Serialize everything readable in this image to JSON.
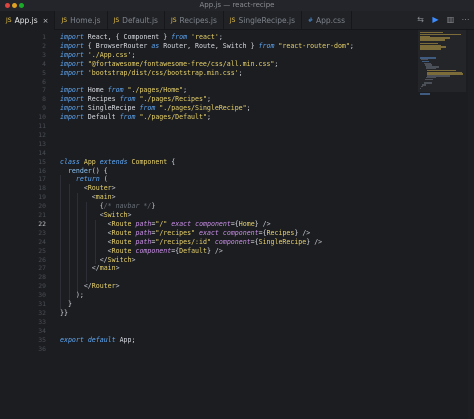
{
  "window": {
    "title": "App.js — react-recipe"
  },
  "tabs": [
    {
      "label": "App.js",
      "active": true
    },
    {
      "label": "Home.js",
      "active": false
    },
    {
      "label": "Default.js",
      "active": false
    },
    {
      "label": "Recipes.js",
      "active": false
    },
    {
      "label": "SingleRecipe.js",
      "active": false
    },
    {
      "label": "App.css",
      "active": false
    }
  ],
  "tab_close_glyph": "×",
  "tab_icon_glyph": "JS",
  "editor": {
    "current_line": 22,
    "line_numbers": [
      "1",
      "2",
      "3",
      "4",
      "5",
      "6",
      "7",
      "8",
      "9",
      "10",
      "11",
      "12",
      "13",
      "14",
      "15",
      "16",
      "17",
      "18",
      "19",
      "20",
      "21",
      "22",
      "23",
      "24",
      "25",
      "26",
      "27",
      "28",
      "29",
      "30",
      "31",
      "32",
      "33",
      "34",
      "35",
      "36"
    ],
    "lines": [
      [
        [
          "kw",
          "import"
        ],
        [
          "pl",
          " React, { Component } "
        ],
        [
          "kw",
          "from"
        ],
        [
          "pl",
          " "
        ],
        [
          "str",
          "'react'"
        ],
        [
          "pl",
          ";"
        ]
      ],
      [
        [
          "kw",
          "import"
        ],
        [
          "pl",
          " { BrowserRouter "
        ],
        [
          "kw",
          "as"
        ],
        [
          "pl",
          " Router, Route, Switch } "
        ],
        [
          "kw",
          "from"
        ],
        [
          "pl",
          " "
        ],
        [
          "str",
          "\"react-router-dom\""
        ],
        [
          "pl",
          ";"
        ]
      ],
      [
        [
          "kw",
          "import"
        ],
        [
          "pl",
          " "
        ],
        [
          "str",
          "'./App.css'"
        ],
        [
          "pl",
          ";"
        ]
      ],
      [
        [
          "kw",
          "import"
        ],
        [
          "pl",
          " "
        ],
        [
          "str",
          "\"@fortawesome/fontawesome-free/css/all.min.css\""
        ],
        [
          "pl",
          ";"
        ]
      ],
      [
        [
          "kw",
          "import"
        ],
        [
          "pl",
          " "
        ],
        [
          "str",
          "'bootstrap/dist/css/bootstrap.min.css'"
        ],
        [
          "pl",
          ";"
        ]
      ],
      [],
      [
        [
          "kw",
          "import"
        ],
        [
          "pl",
          " Home "
        ],
        [
          "kw",
          "from"
        ],
        [
          "pl",
          " "
        ],
        [
          "str",
          "\"./pages/Home\""
        ],
        [
          "pl",
          ";"
        ]
      ],
      [
        [
          "kw",
          "import"
        ],
        [
          "pl",
          " Recipes "
        ],
        [
          "kw",
          "from"
        ],
        [
          "pl",
          " "
        ],
        [
          "str",
          "\"./pages/Recipes\""
        ],
        [
          "pl",
          ";"
        ]
      ],
      [
        [
          "kw",
          "import"
        ],
        [
          "pl",
          " SingleRecipe "
        ],
        [
          "kw",
          "from"
        ],
        [
          "pl",
          " "
        ],
        [
          "str",
          "\"./pages/SingleRecipe\""
        ],
        [
          "pl",
          ";"
        ]
      ],
      [
        [
          "kw",
          "import"
        ],
        [
          "pl",
          " Default "
        ],
        [
          "kw",
          "from"
        ],
        [
          "pl",
          " "
        ],
        [
          "str",
          "\"./pages/Default\""
        ],
        [
          "pl",
          ";"
        ]
      ],
      [],
      [],
      [],
      [],
      [
        [
          "kw",
          "class"
        ],
        [
          "pl",
          " "
        ],
        [
          "cls",
          "App"
        ],
        [
          "pl",
          " "
        ],
        [
          "kw",
          "extends"
        ],
        [
          "pl",
          " "
        ],
        [
          "cls",
          "Component"
        ],
        [
          "pl",
          " {"
        ]
      ],
      [
        [
          "pl",
          "  "
        ],
        [
          "fn",
          "render"
        ],
        [
          "pl",
          "() {"
        ]
      ],
      [
        [
          "pl",
          "    "
        ],
        [
          "kw",
          "return"
        ],
        [
          "pl",
          " ("
        ]
      ],
      [
        [
          "pl",
          "      "
        ],
        [
          "br",
          "<"
        ],
        [
          "tag",
          "Router"
        ],
        [
          "br",
          ">"
        ]
      ],
      [
        [
          "pl",
          "        "
        ],
        [
          "br",
          "<"
        ],
        [
          "tag",
          "main"
        ],
        [
          "br",
          ">"
        ]
      ],
      [
        [
          "pl",
          "          "
        ],
        [
          "br",
          "{"
        ],
        [
          "cmt",
          "/* navbar */"
        ],
        [
          "br",
          "}"
        ]
      ],
      [
        [
          "pl",
          "          "
        ],
        [
          "br",
          "<"
        ],
        [
          "tag",
          "Switch"
        ],
        [
          "br",
          ">"
        ]
      ],
      [
        [
          "pl",
          "            "
        ],
        [
          "br",
          "<"
        ],
        [
          "tag",
          "Route"
        ],
        [
          "pl",
          " "
        ],
        [
          "attr",
          "path"
        ],
        [
          "pl",
          "="
        ],
        [
          "str",
          "\"/\""
        ],
        [
          "pl",
          " "
        ],
        [
          "attr",
          "exact"
        ],
        [
          "pl",
          " "
        ],
        [
          "attr",
          "component"
        ],
        [
          "pl",
          "={"
        ],
        [
          "tag",
          "Home"
        ],
        [
          "pl",
          "} "
        ],
        [
          "br",
          "/>"
        ]
      ],
      [
        [
          "pl",
          "            "
        ],
        [
          "br",
          "<"
        ],
        [
          "tag",
          "Route"
        ],
        [
          "pl",
          " "
        ],
        [
          "attr",
          "path"
        ],
        [
          "pl",
          "="
        ],
        [
          "str",
          "\"/recipes\""
        ],
        [
          "pl",
          " "
        ],
        [
          "attr",
          "exact"
        ],
        [
          "pl",
          " "
        ],
        [
          "attr",
          "component"
        ],
        [
          "pl",
          "={"
        ],
        [
          "tag",
          "Recipes"
        ],
        [
          "pl",
          "} "
        ],
        [
          "br",
          "/>"
        ]
      ],
      [
        [
          "pl",
          "            "
        ],
        [
          "br",
          "<"
        ],
        [
          "tag",
          "Route"
        ],
        [
          "pl",
          " "
        ],
        [
          "attr",
          "path"
        ],
        [
          "pl",
          "="
        ],
        [
          "str",
          "\"/recipes/:id\""
        ],
        [
          "pl",
          " "
        ],
        [
          "attr",
          "component"
        ],
        [
          "pl",
          "={"
        ],
        [
          "tag",
          "SingleRecipe"
        ],
        [
          "pl",
          "} "
        ],
        [
          "br",
          "/>"
        ]
      ],
      [
        [
          "pl",
          "            "
        ],
        [
          "br",
          "<"
        ],
        [
          "tag",
          "Route"
        ],
        [
          "pl",
          " "
        ],
        [
          "attr",
          "component"
        ],
        [
          "pl",
          "={"
        ],
        [
          "tag",
          "Default"
        ],
        [
          "pl",
          "} "
        ],
        [
          "br",
          "/>"
        ]
      ],
      [
        [
          "pl",
          "          "
        ],
        [
          "br",
          "</"
        ],
        [
          "tag",
          "Switch"
        ],
        [
          "br",
          ">"
        ]
      ],
      [
        [
          "pl",
          "        "
        ],
        [
          "br",
          "</"
        ],
        [
          "tag",
          "main"
        ],
        [
          "br",
          ">"
        ]
      ],
      [],
      [
        [
          "pl",
          "      "
        ],
        [
          "br",
          "</"
        ],
        [
          "tag",
          "Router"
        ],
        [
          "br",
          ">"
        ]
      ],
      [
        [
          "pl",
          "    );"
        ]
      ],
      [
        [
          "pl",
          "  }"
        ]
      ],
      [
        [
          "pl",
          "}"
        ],
        [
          "pl",
          "}"
        ]
      ],
      [],
      [],
      [
        [
          "kw",
          "export"
        ],
        [
          "pl",
          " "
        ],
        [
          "kw",
          "default"
        ],
        [
          "pl",
          " App;"
        ]
      ],
      []
    ]
  },
  "colors": {
    "background": "#1b1d21",
    "keyword": "#5fa8f5",
    "string": "#e8d26a",
    "attribute": "#c98fe6",
    "comment": "#6b7079"
  }
}
